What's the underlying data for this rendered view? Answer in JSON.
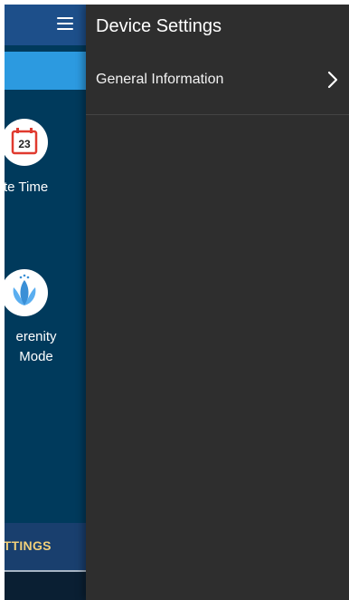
{
  "drawer": {
    "title": "Device Settings",
    "items": [
      {
        "label": "General Information",
        "icon": "chevron-right-icon"
      }
    ]
  },
  "background_app": {
    "menu_icon": "hamburger-menu-icon",
    "tiles": [
      {
        "label_visible": "te Time",
        "icon": "calendar-icon",
        "calendar_day": "23"
      },
      {
        "label_visible": "erenity\nMode",
        "icon": "lotus-icon"
      }
    ],
    "settings_tab_visible": "ETTINGS"
  },
  "colors": {
    "drawer_bg": "#2e2e2e",
    "app_bg": "#003a5c",
    "header_bg": "#1d4f8a",
    "accent_blue": "#2c9ae0",
    "settings_tab_text": "#f2d07a",
    "calendar_red": "#e03a2f"
  }
}
